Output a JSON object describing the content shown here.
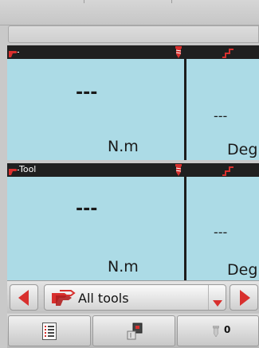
{
  "panels": [
    {
      "tool_label": "",
      "torque_value": "---",
      "torque_unit": "N.m",
      "angle_value": "---",
      "angle_unit": "Deg"
    },
    {
      "tool_label": "Tool",
      "torque_value": "---",
      "torque_unit": "N.m",
      "angle_value": "---",
      "angle_unit": "Deg"
    }
  ],
  "selector": {
    "label": "All tools"
  },
  "bottom": {
    "screw_count": "0"
  },
  "colors": {
    "panel_bg": "#acdbe6",
    "header_bg": "#202020",
    "accent_red": "#d8302e"
  },
  "icons": {
    "tool": "drill-icon",
    "screw": "screw-icon",
    "angle": "angle-step-icon",
    "prev": "left-arrow-icon",
    "next": "right-arrow-icon",
    "list": "list-icon",
    "controller": "controller-icon"
  }
}
